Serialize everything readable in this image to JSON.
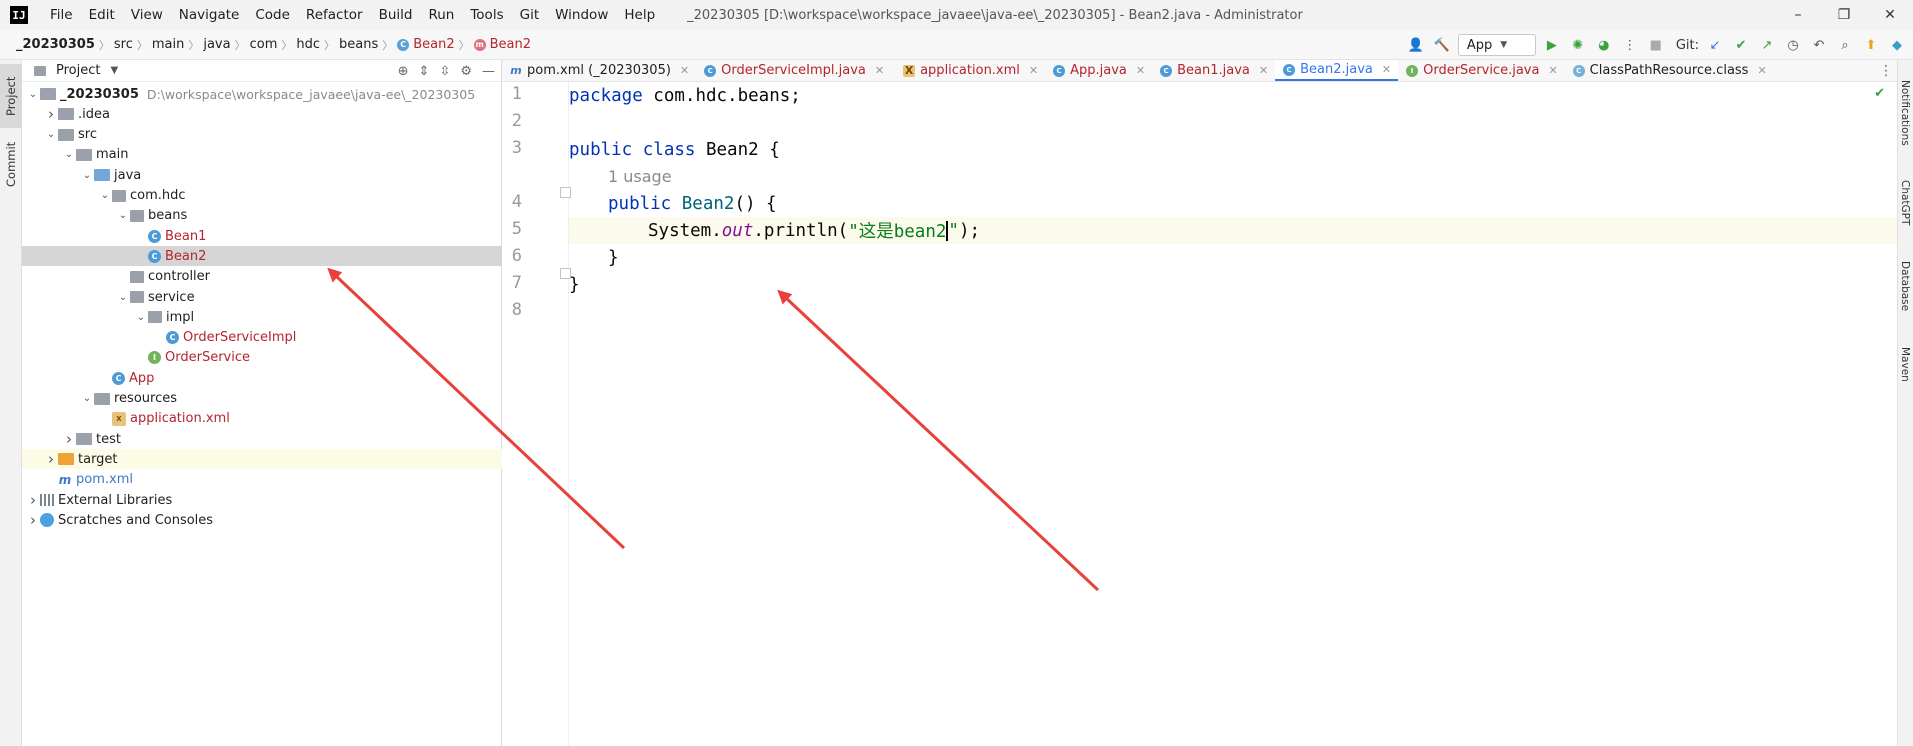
{
  "window": {
    "logo": "IJ",
    "title": "_20230305 [D:\\workspace\\workspace_javaee\\java-ee\\_20230305] - Bean2.java - Administrator",
    "menu": [
      "File",
      "Edit",
      "View",
      "Navigate",
      "Code",
      "Refactor",
      "Build",
      "Run",
      "Tools",
      "Git",
      "Window",
      "Help"
    ],
    "controls": {
      "minimize": "–",
      "restore": "❐",
      "close": "✕"
    }
  },
  "breadcrumb": [
    "_20230305",
    "src",
    "main",
    "java",
    "com",
    "hdc",
    "beans",
    "Bean2",
    "Bean2"
  ],
  "toolbar": {
    "run_config": "App",
    "git_label": "Git:"
  },
  "left_strip": {
    "project": "Project",
    "commit": "Commit"
  },
  "right_strip": [
    "Notifications",
    "ChatGPT",
    "Database",
    "Maven"
  ],
  "project_panel": {
    "title": "Project",
    "tree": [
      {
        "label": "_20230305",
        "path": "D:\\workspace\\workspace_javaee\\java-ee\\_20230305",
        "icon": "folder",
        "depth": 0,
        "expanded": true,
        "bold": true
      },
      {
        "label": ".idea",
        "icon": "folder",
        "depth": 1,
        "expanded": false
      },
      {
        "label": "src",
        "icon": "folder",
        "depth": 1,
        "expanded": true
      },
      {
        "label": "main",
        "icon": "folder",
        "depth": 2,
        "expanded": true
      },
      {
        "label": "java",
        "icon": "folder-blue",
        "depth": 3,
        "expanded": true
      },
      {
        "label": "com.hdc",
        "icon": "package",
        "depth": 4,
        "expanded": true
      },
      {
        "label": "beans",
        "icon": "package",
        "depth": 5,
        "expanded": true
      },
      {
        "label": "Bean1",
        "icon": "class",
        "depth": 6,
        "red": true
      },
      {
        "label": "Bean2",
        "icon": "class",
        "depth": 6,
        "red": true,
        "selected": true
      },
      {
        "label": "controller",
        "icon": "package",
        "depth": 5
      },
      {
        "label": "service",
        "icon": "package",
        "depth": 5,
        "expanded": true
      },
      {
        "label": "impl",
        "icon": "package",
        "depth": 6,
        "expanded": true
      },
      {
        "label": "OrderServiceImpl",
        "icon": "class",
        "depth": 7,
        "red": true
      },
      {
        "label": "OrderService",
        "icon": "interface",
        "depth": 6,
        "red": true
      },
      {
        "label": "App",
        "icon": "class",
        "depth": 4,
        "red": true
      },
      {
        "label": "resources",
        "icon": "folder-res",
        "depth": 3,
        "expanded": true
      },
      {
        "label": "application.xml",
        "icon": "xml",
        "depth": 4,
        "red": true
      },
      {
        "label": "test",
        "icon": "folder",
        "depth": 2,
        "expanded": false
      },
      {
        "label": "target",
        "icon": "folder-orange",
        "depth": 1,
        "expanded": false,
        "highlight": true
      },
      {
        "label": "pom.xml",
        "icon": "maven",
        "depth": 1,
        "maven": true
      },
      {
        "label": "External Libraries",
        "icon": "library",
        "depth": 0,
        "expanded": false
      },
      {
        "label": "Scratches and Consoles",
        "icon": "scratch",
        "depth": 0,
        "expanded": false
      }
    ]
  },
  "editor": {
    "tabs": [
      {
        "label": "pom.xml (_20230305)",
        "icon": "m",
        "red": false
      },
      {
        "label": "OrderServiceImpl.java",
        "icon": "c",
        "red": true
      },
      {
        "label": "application.xml",
        "icon": "x",
        "red": true
      },
      {
        "label": "App.java",
        "icon": "c",
        "red": true
      },
      {
        "label": "Bean1.java",
        "icon": "c",
        "red": true
      },
      {
        "label": "Bean2.java",
        "icon": "c",
        "active": true
      },
      {
        "label": "OrderService.java",
        "icon": "i",
        "red": true
      },
      {
        "label": "ClassPathResource.class",
        "icon": "cls",
        "red": false
      }
    ],
    "line_numbers": [
      "1",
      "2",
      "3",
      "4",
      "5",
      "6",
      "7",
      "8"
    ],
    "usage_hint": "1 usage",
    "code": {
      "l1_kw": "package",
      "l1_rest": " com.hdc.beans;",
      "l3_kw1": "public",
      "l3_kw2": " class",
      "l3_rest": " Bean2 {",
      "l4_kw": "public",
      "l4_name": " Bean2",
      "l4_rest": "() {",
      "l5_a": "System.",
      "l5_field": "out",
      "l5_b": ".println(",
      "l5_str_a": "\"这是bean2",
      "l5_str_b": "\"",
      "l5_end": ");",
      "l6": "}",
      "l7": "}"
    }
  },
  "colors": {
    "annotation_arrow": "#e8403a",
    "accent": "#3574f0"
  }
}
